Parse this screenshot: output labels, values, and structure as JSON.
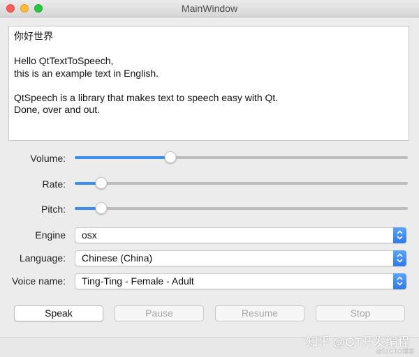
{
  "window": {
    "title": "MainWindow"
  },
  "text_area": {
    "content": "你好世界\n\nHello QtTextToSpeech,\nthis is an example text in English.\n\nQtSpeech is a library that makes text to speech easy with Qt.\nDone, over and out."
  },
  "sliders": {
    "volume": {
      "label": "Volume:",
      "value_fraction": 0.28
    },
    "rate": {
      "label": "Rate:",
      "value_fraction": 0.065
    },
    "pitch": {
      "label": "Pitch:",
      "value_fraction": 0.065
    }
  },
  "combos": {
    "engine": {
      "label": "Engine",
      "value": "osx"
    },
    "language": {
      "label": "Language:",
      "value": "Chinese (China)"
    },
    "voice": {
      "label": "Voice name:",
      "value": "Ting-Ting - Female - Adult"
    }
  },
  "buttons": {
    "speak": "Speak",
    "pause": "Pause",
    "resume": "Resume",
    "stop": "Stop"
  },
  "watermark": {
    "main": "知乎 @QT开发编程",
    "small": "@51CTO博客"
  },
  "colors": {
    "accent": "#3d8ef3",
    "close": "#fc5f57",
    "minimize": "#fdbc2e",
    "maximize": "#28c840"
  }
}
